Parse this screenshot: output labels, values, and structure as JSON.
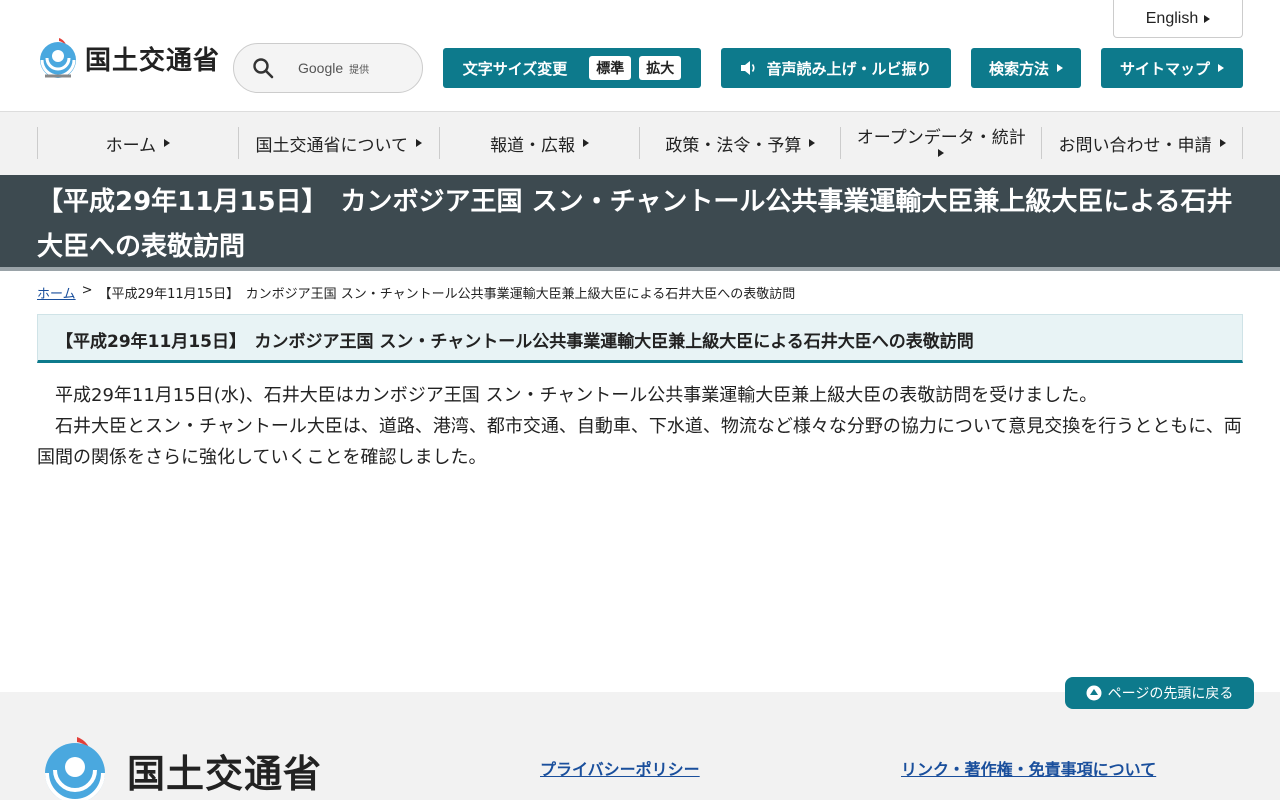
{
  "header": {
    "logo_text": "国土交通省",
    "search": {
      "provider": "Google",
      "provided_label": "提供"
    },
    "english_label": "English",
    "font_size": {
      "label": "文字サイズ変更",
      "standard": "標準",
      "large": "拡大"
    },
    "voice_label": "音声読み上げ・ルビ振り",
    "search_method_label": "検索方法",
    "sitemap_label": "サイトマップ"
  },
  "gnav": {
    "items": [
      {
        "label": "ホーム"
      },
      {
        "label": "国土交通省について"
      },
      {
        "label": "報道・広報"
      },
      {
        "label": "政策・法令・予算"
      },
      {
        "label": "オープンデータ・統計"
      },
      {
        "label": "お問い合わせ・申請"
      }
    ]
  },
  "page": {
    "title": "【平成29年11月15日】　カンボジア王国 スン・チャントール公共事業運輸大臣兼上級大臣による石井大臣への表敬訪問",
    "breadcrumb": {
      "home": "ホーム",
      "separator": ">",
      "current": "【平成29年11月15日】　カンボジア王国 スン・チャントール公共事業運輸大臣兼上級大臣による石井大臣への表敬訪問"
    },
    "heading": "【平成29年11月15日】　カンボジア王国 スン・チャントール公共事業運輸大臣兼上級大臣による石井大臣への表敬訪問",
    "paragraphs": [
      "平成29年11月15日(水)、石井大臣はカンボジア王国 スン・チャントール公共事業運輸大臣兼上級大臣の表敬訪問を受けました。",
      "石井大臣とスン・チャントール大臣は、道路、港湾、都市交通、自動車、下水道、物流など様々な分野の協力について意見交換を行うとともに、両国間の関係をさらに強化していくことを確認しました。"
    ]
  },
  "footer": {
    "pagetop_label": "ページの先頭に戻る",
    "logo_text": "国土交通省",
    "links": [
      {
        "label": "プライバシーポリシー"
      },
      {
        "label": "リンク・著作権・免責事項について"
      }
    ]
  },
  "colors": {
    "accent": "#0d7a8c",
    "title_band": "#3d4a50",
    "link": "#1a4f9c"
  }
}
